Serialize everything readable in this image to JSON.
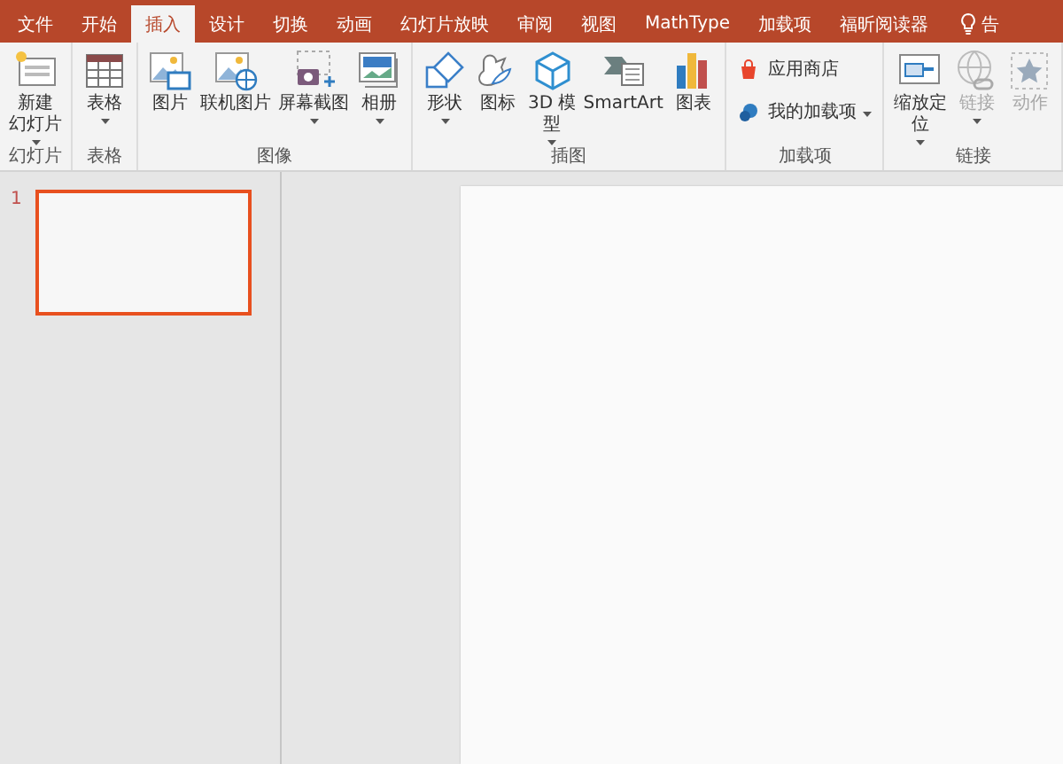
{
  "tabs": [
    {
      "label": "文件",
      "selected": false
    },
    {
      "label": "开始",
      "selected": false
    },
    {
      "label": "插入",
      "selected": true
    },
    {
      "label": "设计",
      "selected": false
    },
    {
      "label": "切换",
      "selected": false
    },
    {
      "label": "动画",
      "selected": false
    },
    {
      "label": "幻灯片放映",
      "selected": false
    },
    {
      "label": "审阅",
      "selected": false
    },
    {
      "label": "视图",
      "selected": false
    },
    {
      "label": "MathType",
      "selected": false
    },
    {
      "label": "加载项",
      "selected": false
    },
    {
      "label": "福昕阅读器",
      "selected": false
    }
  ],
  "tell_me": "告",
  "ribbon": {
    "groups": [
      {
        "label": "幻灯片",
        "items": [
          {
            "kind": "large",
            "lines": [
              "新建",
              "幻灯片"
            ],
            "dropdown": true,
            "disabled": false
          }
        ]
      },
      {
        "label": "表格",
        "items": [
          {
            "kind": "large",
            "lines": [
              "表格"
            ],
            "dropdown": true,
            "disabled": false
          }
        ]
      },
      {
        "label": "图像",
        "items": [
          {
            "kind": "large",
            "lines": [
              "图片"
            ],
            "dropdown": false,
            "disabled": false
          },
          {
            "kind": "large",
            "lines": [
              "联机图片"
            ],
            "dropdown": false,
            "disabled": false
          },
          {
            "kind": "large",
            "lines": [
              "屏幕截图"
            ],
            "dropdown": true,
            "disabled": false
          },
          {
            "kind": "large",
            "lines": [
              "相册"
            ],
            "dropdown": true,
            "disabled": false
          }
        ]
      },
      {
        "label": "插图",
        "items": [
          {
            "kind": "large",
            "lines": [
              "形状"
            ],
            "dropdown": true,
            "disabled": false
          },
          {
            "kind": "large",
            "lines": [
              "图标"
            ],
            "dropdown": false,
            "disabled": false
          },
          {
            "kind": "large",
            "lines": [
              "3D 模",
              "型"
            ],
            "dropdown": true,
            "disabled": false
          },
          {
            "kind": "large",
            "lines": [
              "SmartArt"
            ],
            "dropdown": false,
            "disabled": false
          },
          {
            "kind": "large",
            "lines": [
              "图表"
            ],
            "dropdown": false,
            "disabled": false
          }
        ]
      },
      {
        "label": "加载项",
        "items": [
          {
            "kind": "small",
            "lines": [
              "应用商店"
            ],
            "dropdown": false,
            "disabled": false
          },
          {
            "kind": "small",
            "lines": [
              "我的加载项"
            ],
            "dropdown": true,
            "disabled": false
          }
        ]
      },
      {
        "label": "链接",
        "items": [
          {
            "kind": "large",
            "lines": [
              "缩放定",
              "位"
            ],
            "dropdown": true,
            "disabled": false
          },
          {
            "kind": "large",
            "lines": [
              "链接"
            ],
            "dropdown": true,
            "disabled": true
          },
          {
            "kind": "large",
            "lines": [
              "动作"
            ],
            "dropdown": false,
            "disabled": true
          }
        ]
      }
    ]
  },
  "slides": [
    {
      "number": "1",
      "selected": true
    }
  ]
}
